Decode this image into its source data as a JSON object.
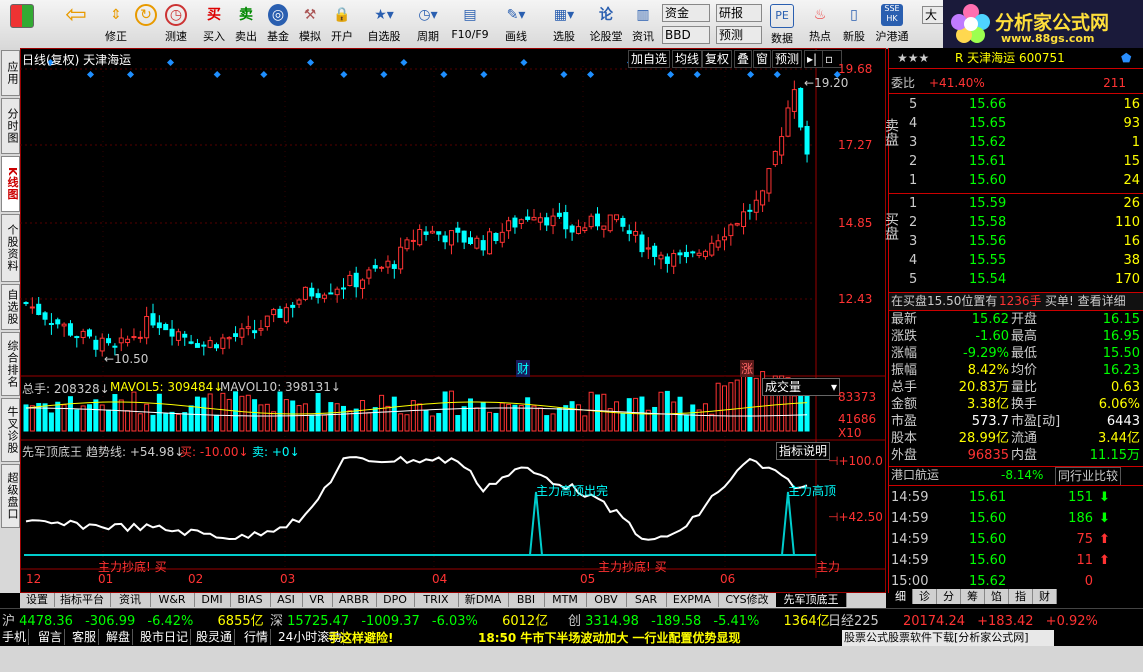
{
  "toolbar": {
    "buttons": [
      {
        "label": "",
        "icon": "windows-logo-icon"
      },
      {
        "label": "",
        "icon": "back-arrow-icon"
      },
      {
        "label": "修正"
      },
      {
        "label": "测速"
      },
      {
        "label": "买入",
        "glyph": "买"
      },
      {
        "label": "卖出",
        "glyph": "卖"
      },
      {
        "label": "基金"
      },
      {
        "label": "模拟"
      },
      {
        "label": "开户"
      },
      {
        "label": "自选股"
      },
      {
        "label": "周期"
      },
      {
        "label": "F10/F9"
      },
      {
        "label": "画线"
      },
      {
        "label": "选股"
      },
      {
        "label": "论股堂",
        "glyph": "论"
      },
      {
        "label": "资讯"
      },
      {
        "label": "数据",
        "glyph": "PE"
      },
      {
        "label": "热点"
      },
      {
        "label": "新股"
      },
      {
        "label": "沪港通",
        "glyph": "SSE HK"
      }
    ],
    "mini_buttons": [
      "资金",
      "研报",
      "BBD",
      "预测",
      "大"
    ],
    "brand_title": "分析家公式网",
    "brand_url": "www.88gs.com"
  },
  "left_tabs": [
    "应用",
    "分时图",
    "K线图",
    "个股资料",
    "自选股",
    "综合排名",
    "牛叉诊股",
    "超级盘口"
  ],
  "chart": {
    "title": "日线(复权)  天津海运",
    "top_buttons": [
      "加自选",
      "均线",
      "复权",
      "叠",
      "窗",
      "预测"
    ],
    "price_axis": [
      "19.68",
      "17.27",
      "14.85",
      "12.43"
    ],
    "high_label": "19.20",
    "low_label": "10.50",
    "markers": [
      "财",
      "涨"
    ],
    "volume_header": {
      "total": "总手: 208328",
      "ma5": "MAVOL5: 309484",
      "ma10": "MAVOL10: 398131"
    },
    "volume_select": "成交量",
    "volume_axis": [
      "83373",
      "41686",
      "X10"
    ],
    "indicator_header": {
      "name": "先军顶底王",
      "trend": "趋势线: +54.98",
      "buy": "买: -10.00",
      "sell": "卖: +0"
    },
    "indicator_button": "指标说明",
    "indicator_axis": [
      "+100.0",
      "+42.50"
    ],
    "indicator_labels": [
      "主力高顶出完",
      "主力高顶",
      "主力抄底! 买",
      "主力抄底! 买",
      "主力"
    ],
    "x_axis": [
      "12",
      "01",
      "02",
      "03",
      "04",
      "05",
      "06"
    ]
  },
  "bottom_tabs": [
    "设置",
    "指标平台",
    "资讯",
    "W&R",
    "DMI",
    "BIAS",
    "ASI",
    "VR",
    "ARBR",
    "DPO",
    "TRIX",
    "新DMA",
    "BBI",
    "MTM",
    "OBV",
    "SAR",
    "EXPMA",
    "CYS修改",
    "先军顶底王"
  ],
  "quote": {
    "header": {
      "name": "R 天津海运 600751",
      "stars": "★★★"
    },
    "weibi": {
      "label": "委比",
      "pct": "+41.40%",
      "diff": "211"
    },
    "sell_label": "卖盘",
    "buy_label": "买盘",
    "sell": [
      {
        "lvl": "5",
        "price": "15.66",
        "vol": "16"
      },
      {
        "lvl": "4",
        "price": "15.65",
        "vol": "93"
      },
      {
        "lvl": "3",
        "price": "15.62",
        "vol": "1"
      },
      {
        "lvl": "2",
        "price": "15.61",
        "vol": "15"
      },
      {
        "lvl": "1",
        "price": "15.60",
        "vol": "24"
      }
    ],
    "buy": [
      {
        "lvl": "1",
        "price": "15.59",
        "vol": "26"
      },
      {
        "lvl": "2",
        "price": "15.58",
        "vol": "110"
      },
      {
        "lvl": "3",
        "price": "15.56",
        "vol": "16"
      },
      {
        "lvl": "4",
        "price": "15.55",
        "vol": "38"
      },
      {
        "lvl": "5",
        "price": "15.54",
        "vol": "170"
      }
    ],
    "notice": {
      "text": "在买盘15.50位置有",
      "vol": "1236手",
      "action": "买单! 查看详细"
    },
    "stats": [
      {
        "l1": "最新",
        "v1": "15.62",
        "c1": "#00ff00",
        "l2": "开盘",
        "v2": "16.15",
        "c2": "#00ff00"
      },
      {
        "l1": "涨跌",
        "v1": "-1.60",
        "c1": "#00ff00",
        "l2": "最高",
        "v2": "16.95",
        "c2": "#00ff00"
      },
      {
        "l1": "涨幅",
        "v1": "-9.29%",
        "c1": "#00ff00",
        "l2": "最低",
        "v2": "15.50",
        "c2": "#00ff00"
      },
      {
        "l1": "振幅",
        "v1": "8.42%",
        "c1": "#ffff00",
        "l2": "均价",
        "v2": "16.23",
        "c2": "#00ff00"
      },
      {
        "l1": "总手",
        "v1": "20.83万",
        "c1": "#ffff00",
        "l2": "量比",
        "v2": "0.63",
        "c2": "#ffff00"
      },
      {
        "l1": "金额",
        "v1": "3.38亿",
        "c1": "#ffff00",
        "l2": "换手",
        "v2": "6.06%",
        "c2": "#ffff00"
      },
      {
        "l1": "市盈",
        "v1": "573.7",
        "c1": "#ffffff",
        "l2": "市盈[动]",
        "v2": "6443",
        "c2": "#ffffff"
      },
      {
        "l1": "股本",
        "v1": "28.99亿",
        "c1": "#ffff00",
        "l2": "流通",
        "v2": "3.44亿",
        "c2": "#ffff00"
      },
      {
        "l1": "外盘",
        "v1": "96835",
        "c1": "#ff3333",
        "l2": "内盘",
        "v2": "11.15万",
        "c2": "#00ff00"
      }
    ],
    "industry": {
      "name": "港口航运",
      "pct": "-8.14%",
      "button": "同行业比较"
    },
    "ticks": [
      {
        "t": "14:59",
        "p": "15.61",
        "v": "151",
        "dir": "down"
      },
      {
        "t": "14:59",
        "p": "15.60",
        "v": "186",
        "dir": "down"
      },
      {
        "t": "14:59",
        "p": "15.60",
        "v": "75",
        "dir": "up"
      },
      {
        "t": "14:59",
        "p": "15.60",
        "v": "11",
        "dir": "up"
      },
      {
        "t": "15:00",
        "p": "15.62",
        "v": "0",
        "dir": "none"
      }
    ],
    "tabs": [
      "细",
      "诊",
      "分",
      "筹",
      "馅",
      "指",
      "财"
    ]
  },
  "index_bar": {
    "sh": {
      "name": "沪",
      "val": "4478.36",
      "chg": "-306.99",
      "pct": "-6.42%",
      "amt": "6855亿"
    },
    "sz": {
      "name": "深",
      "val": "15725.47",
      "chg": "-1009.37",
      "pct": "-6.03%",
      "amt": "6012亿"
    },
    "cy": {
      "name": "创",
      "val": "3314.98",
      "chg": "-189.58",
      "pct": "-5.41%",
      "amt": "1364亿"
    },
    "rj": {
      "name": "日经225",
      "val": "20174.24",
      "chg": "+183.42",
      "pct": "+0.92%"
    }
  },
  "status_bar": {
    "buttons": [
      "手机",
      "留言",
      "客服",
      "解盘",
      "股市日记",
      "股灵通",
      "行情",
      "24小时滚动"
    ],
    "news1": "手这样避险!",
    "news2": "18:50 牛市下半场波动加大 一行业配置优势显现",
    "ad": "股票公式股票软件下载[分析家公式网]"
  },
  "colors": {
    "up": "#ff3333",
    "down": "#00ffff",
    "text_yellow": "#ffff00",
    "grid_red": "#990000"
  }
}
